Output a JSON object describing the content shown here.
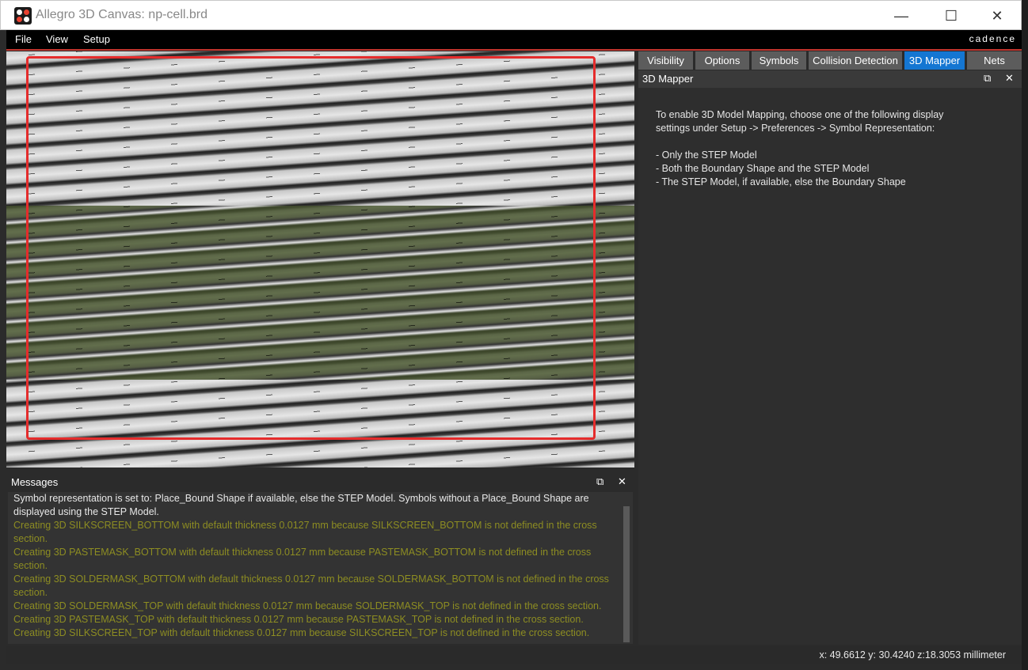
{
  "window": {
    "title": "Allegro 3D Canvas: np-cell.brd"
  },
  "titlebar_controls": {
    "minimize": "—",
    "maximize": "☐",
    "close": "✕"
  },
  "menu": {
    "file": "File",
    "view": "View",
    "setup": "Setup",
    "brand": "cadence"
  },
  "tabs": [
    "Visibility",
    "Options",
    "Symbols",
    "Collision Detection",
    "3D Mapper",
    "Nets"
  ],
  "active_tab": "3D Mapper",
  "mapper_panel": {
    "title": "3D Mapper",
    "intro_line1": "To enable 3D Model Mapping, choose one of the following display",
    "intro_line2": "settings under Setup -> Preferences -> Symbol Representation:",
    "option1": "- Only the STEP Model",
    "option2": "- Both the Boundary Shape and the STEP Model",
    "option3": "- The STEP Model, if available, else the Boundary Shape"
  },
  "messages": {
    "title": "Messages",
    "lines": [
      "Symbol representation is set to: Place_Bound Shape if available, else the STEP Model.  Symbols without a Place_Bound Shape are",
      "displayed using the STEP Model.",
      "Creating 3D SILKSCREEN_BOTTOM with default thickness 0.0127 mm because SILKSCREEN_BOTTOM is not defined in the cross",
      "section.",
      "Creating 3D PASTEMASK_BOTTOM with default thickness 0.0127 mm because PASTEMASK_BOTTOM is not defined in the cross",
      "section.",
      "Creating 3D SOLDERMASK_BOTTOM with default thickness 0.0127 mm because SOLDERMASK_BOTTOM is not defined in the cross",
      "section.",
      "Creating 3D SOLDERMASK_TOP with default thickness 0.0127 mm because SOLDERMASK_TOP is not defined in the cross section.",
      "Creating 3D PASTEMASK_TOP with default thickness 0.0127 mm because PASTEMASK_TOP is not defined in the cross section.",
      "Creating 3D SILKSCREEN_TOP with default thickness 0.0127 mm because SILKSCREEN_TOP is not defined in the cross section."
    ]
  },
  "status": {
    "coords": "x: 49.6612 y: 30.4240 z:18.3053 millimeter"
  },
  "colors": {
    "active_tab": "#1476d2",
    "highlight_box": "#e52c2c",
    "message_text": "#8d8d22"
  }
}
